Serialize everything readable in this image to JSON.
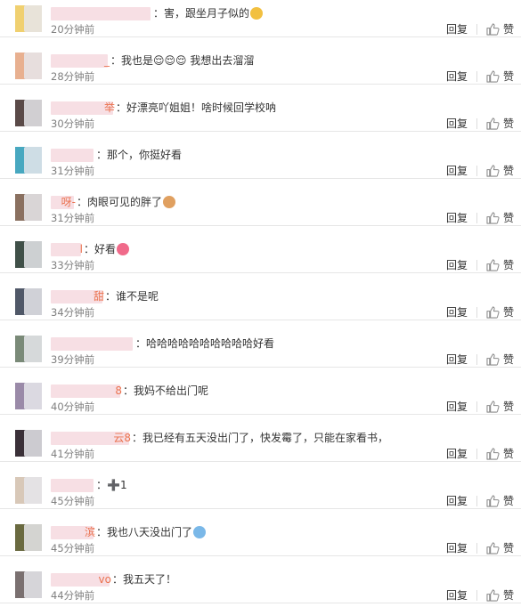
{
  "actions": {
    "reply_label": "回复",
    "like_label": "赞"
  },
  "comments": [
    {
      "user_visible": "",
      "tail": "",
      "text": "害，跟坐月子似的",
      "emoji": "person-emoji",
      "time": "20分钟前",
      "avatar": "#f0d070"
    },
    {
      "user_visible": "",
      "tail": "_",
      "text": "我也是😌😌😌  我想出去溜溜",
      "emoji": "",
      "time": "28分钟前",
      "avatar": "#e8b090"
    },
    {
      "user_visible": "",
      "tail": "举",
      "text": "好漂亮吖姐姐！啥时候回学校呐",
      "emoji": "",
      "time": "30分钟前",
      "avatar": "#5a4a48"
    },
    {
      "user_visible": "",
      "tail": "",
      "text": "那个，你挺好看",
      "emoji": "",
      "time": "31分钟前",
      "avatar": "#48a8c0"
    },
    {
      "user_visible": "",
      "tail": "呀-",
      "text": "肉眼可见的胖了",
      "emoji": "dog-emoji",
      "time": "31分钟前",
      "avatar": "#8a7060"
    },
    {
      "user_visible": "",
      "tail": "l",
      "text": "好看",
      "emoji": "heart-emoji",
      "time": "33分钟前",
      "avatar": "#405048"
    },
    {
      "user_visible": "",
      "tail": "甜",
      "text": "谁不是呢",
      "emoji": "",
      "time": "34分钟前",
      "avatar": "#505868"
    },
    {
      "user_visible": "",
      "tail": "",
      "text": "哈哈哈哈哈哈哈哈哈哈好看",
      "emoji": "",
      "time": "39分钟前",
      "avatar": "#7a8a78"
    },
    {
      "user_visible": "",
      "tail": "8",
      "text": "我妈不给出门呢",
      "emoji": "",
      "time": "40分钟前",
      "avatar": "#9a8aa8"
    },
    {
      "user_visible": "",
      "tail": "云8",
      "text": "我已经有五天没出门了，快发霉了，只能在家看书，",
      "emoji": "",
      "time": "41分钟前",
      "avatar": "#3a3038"
    },
    {
      "user_visible": "",
      "tail": "",
      "text": "➕1",
      "emoji": "",
      "time": "45分钟前",
      "avatar": "#d8c8b8"
    },
    {
      "user_visible": "",
      "tail": "滨",
      "text": "我也八天没出门了",
      "emoji": "sweat-emoji",
      "time": "45分钟前",
      "avatar": "#6a6a40"
    },
    {
      "user_visible": "",
      "tail": "vo",
      "text": "我五天了！",
      "emoji": "",
      "time": "44分钟前",
      "avatar": "#7a7070"
    }
  ],
  "colors": {
    "username_blur": "#f7dfe4",
    "username_accent": "#eb7350",
    "time": "#808080",
    "divider": "#e6e6e6"
  }
}
